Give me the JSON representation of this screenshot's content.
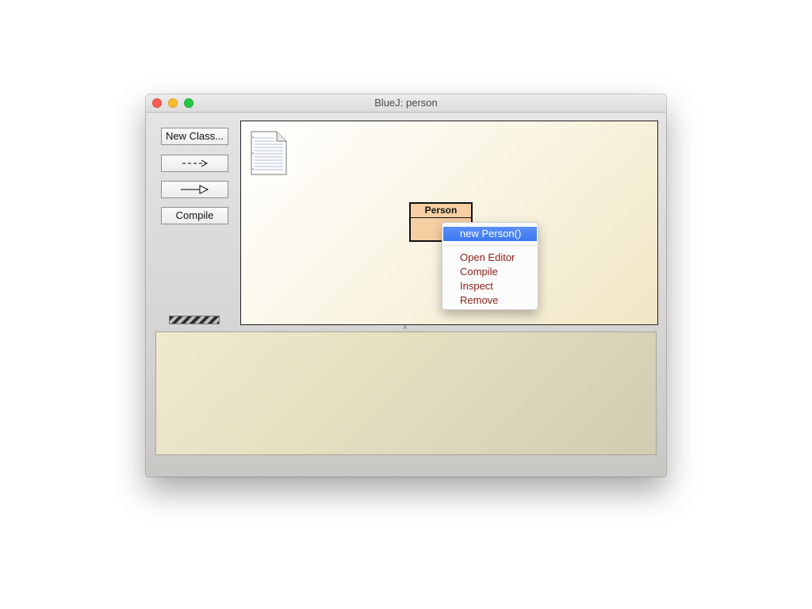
{
  "window": {
    "title": "BlueJ:  person"
  },
  "toolbar": {
    "new_class_label": "New Class...",
    "uses_arrow_label": "--->",
    "inherits_arrow_label": "—▷",
    "compile_label": "Compile"
  },
  "diagram": {
    "class_name": "Person"
  },
  "context_menu": {
    "items": [
      {
        "label": "new Person()",
        "selected": true
      },
      {
        "label": "Open Editor"
      },
      {
        "label": "Compile"
      },
      {
        "label": "Inspect"
      },
      {
        "label": "Remove"
      }
    ]
  },
  "colors": {
    "class_fill": "#f5cfa2",
    "menu_text": "#8b1f1a",
    "menu_highlight": "#3c78f0"
  }
}
